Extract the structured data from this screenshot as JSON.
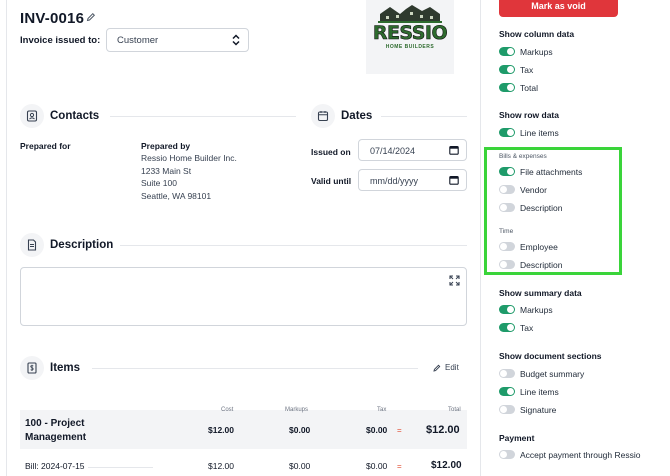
{
  "colors": {
    "accent_green": "#1f9b6a",
    "danger_red": "#e0363b",
    "highlight_green": "#3ad43a",
    "muted": "#6b7280"
  },
  "invoice": {
    "number": "INV-0016",
    "issued_to_label": "Invoice issued to:",
    "issued_to_value": "Customer",
    "logo_text": "RESSIO",
    "logo_subtext": "HOME BUILDERS"
  },
  "contacts": {
    "title": "Contacts",
    "prepared_for_label": "Prepared for",
    "prepared_by_label": "Prepared by",
    "prepared_by_lines": [
      "Ressio Home Builder Inc.",
      "1233 Main St",
      "Suite 100",
      "Seattle, WA 98101"
    ]
  },
  "dates": {
    "title": "Dates",
    "issued_on_label": "Issued on",
    "issued_on_value": "07/14/2024",
    "valid_until_label": "Valid until",
    "valid_until_placeholder": "mm/dd/yyyy"
  },
  "description": {
    "title": "Description"
  },
  "items": {
    "title": "Items",
    "edit_label": "Edit",
    "columns": {
      "cost": "Cost",
      "markups": "Markups",
      "tax": "Tax",
      "total": "Total"
    },
    "group": {
      "name": "100 - Project Management",
      "cost": "$12.00",
      "markups": "$0.00",
      "tax": "$0.00",
      "eq": "=",
      "total": "$12.00"
    },
    "rows": [
      {
        "name": "Bill: 2024-07-15",
        "cost": "$12.00",
        "markups": "$0.00",
        "tax": "$0.00",
        "eq": "=",
        "total": "$12.00"
      }
    ]
  },
  "sidebar": {
    "void_button": "Mark as void",
    "column_data": {
      "title": "Show column data",
      "toggles": [
        {
          "label": "Markups",
          "on": true
        },
        {
          "label": "Tax",
          "on": true
        },
        {
          "label": "Total",
          "on": true
        }
      ]
    },
    "row_data": {
      "title": "Show row data",
      "toggles": [
        {
          "label": "Line items",
          "on": true
        }
      ]
    },
    "bills_expenses": {
      "title": "Bills & expenses",
      "toggles": [
        {
          "label": "File attachments",
          "on": true
        },
        {
          "label": "Vendor",
          "on": false
        },
        {
          "label": "Description",
          "on": false
        }
      ]
    },
    "time": {
      "title": "Time",
      "toggles": [
        {
          "label": "Employee",
          "on": false
        },
        {
          "label": "Description",
          "on": false
        }
      ]
    },
    "summary_data": {
      "title": "Show summary data",
      "toggles": [
        {
          "label": "Markups",
          "on": true
        },
        {
          "label": "Tax",
          "on": true
        }
      ]
    },
    "document_sections": {
      "title": "Show document sections",
      "toggles": [
        {
          "label": "Budget summary",
          "on": false
        },
        {
          "label": "Line items",
          "on": true
        },
        {
          "label": "Signature",
          "on": false
        }
      ]
    },
    "payment": {
      "title": "Payment",
      "toggles": [
        {
          "label": "Accept payment through Ressio",
          "on": false
        }
      ]
    }
  }
}
